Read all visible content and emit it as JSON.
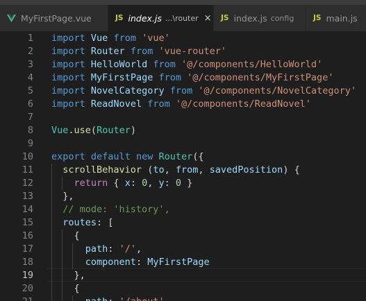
{
  "tabs": [
    {
      "filename": "MyFirstPage.vue",
      "description": "",
      "icon": "vue-icon",
      "active": false,
      "italic": false
    },
    {
      "filename": "index.js",
      "description": "...\\router",
      "icon": "js-icon",
      "active": true,
      "italic": true,
      "close": "×"
    },
    {
      "filename": "index.js",
      "description": "config",
      "icon": "js-icon",
      "active": false,
      "italic": false
    },
    {
      "filename": "main.js",
      "description": "",
      "icon": "js-icon",
      "active": false,
      "italic": false
    }
  ],
  "js_icon_label": "JS",
  "editor": {
    "current_line": 19,
    "line_numbers": [
      "1",
      "2",
      "3",
      "4",
      "5",
      "6",
      "7",
      "8",
      "9",
      "10",
      "11",
      "12",
      "13",
      "14",
      "15",
      "16",
      "17",
      "18",
      "19",
      "20",
      "21"
    ],
    "lines": [
      [
        [
          "kw",
          "import"
        ],
        [
          "pl",
          " "
        ],
        [
          "var",
          "Vue"
        ],
        [
          "pl",
          " "
        ],
        [
          "kw",
          "from"
        ],
        [
          "pl",
          " "
        ],
        [
          "str",
          "'vue'"
        ]
      ],
      [
        [
          "kw",
          "import"
        ],
        [
          "pl",
          " "
        ],
        [
          "var",
          "Router"
        ],
        [
          "pl",
          " "
        ],
        [
          "kw",
          "from"
        ],
        [
          "pl",
          " "
        ],
        [
          "str",
          "'vue-router'"
        ]
      ],
      [
        [
          "kw",
          "import"
        ],
        [
          "pl",
          " "
        ],
        [
          "var",
          "HelloWorld"
        ],
        [
          "pl",
          " "
        ],
        [
          "kw",
          "from"
        ],
        [
          "pl",
          " "
        ],
        [
          "str",
          "'@/components/HelloWorld'"
        ]
      ],
      [
        [
          "kw",
          "import"
        ],
        [
          "pl",
          " "
        ],
        [
          "var",
          "MyFirstPage"
        ],
        [
          "pl",
          " "
        ],
        [
          "kw",
          "from"
        ],
        [
          "pl",
          " "
        ],
        [
          "str",
          "'@/components/MyFirstPage'"
        ]
      ],
      [
        [
          "kw",
          "import"
        ],
        [
          "pl",
          " "
        ],
        [
          "var",
          "NovelCategory"
        ],
        [
          "pl",
          " "
        ],
        [
          "kw",
          "from"
        ],
        [
          "pl",
          " "
        ],
        [
          "str",
          "'@/components/NovelCategory'"
        ]
      ],
      [
        [
          "kw",
          "import"
        ],
        [
          "pl",
          " "
        ],
        [
          "var",
          "ReadNovel"
        ],
        [
          "pl",
          " "
        ],
        [
          "kw",
          "from"
        ],
        [
          "pl",
          " "
        ],
        [
          "str",
          "'@/components/ReadNovel'"
        ]
      ],
      [],
      [
        [
          "cls",
          "Vue"
        ],
        [
          "pl",
          "."
        ],
        [
          "fn",
          "use"
        ],
        [
          "pl",
          "("
        ],
        [
          "cls",
          "Router"
        ],
        [
          "pl",
          ")"
        ]
      ],
      [],
      [
        [
          "kw",
          "export"
        ],
        [
          "pl",
          " "
        ],
        [
          "kw",
          "default"
        ],
        [
          "pl",
          " "
        ],
        [
          "kw",
          "new"
        ],
        [
          "pl",
          " "
        ],
        [
          "cls",
          "Router"
        ],
        [
          "pl",
          "({"
        ]
      ],
      [
        [
          "pl",
          "  "
        ],
        [
          "fn",
          "scrollBehavior"
        ],
        [
          "pl",
          " ("
        ],
        [
          "var",
          "to"
        ],
        [
          "pl",
          ", "
        ],
        [
          "var",
          "from"
        ],
        [
          "pl",
          ", "
        ],
        [
          "var",
          "savedPosition"
        ],
        [
          "pl",
          ") {"
        ]
      ],
      [
        [
          "pl",
          "    "
        ],
        [
          "ctrl",
          "return"
        ],
        [
          "pl",
          " { "
        ],
        [
          "var",
          "x"
        ],
        [
          "pl",
          ": "
        ],
        [
          "num",
          "0"
        ],
        [
          "pl",
          ", "
        ],
        [
          "var",
          "y"
        ],
        [
          "pl",
          ": "
        ],
        [
          "num",
          "0"
        ],
        [
          "pl",
          " }"
        ]
      ],
      [
        [
          "pl",
          "  },"
        ]
      ],
      [
        [
          "pl",
          "  "
        ],
        [
          "cm",
          "// mode: 'history',"
        ]
      ],
      [
        [
          "pl",
          "  "
        ],
        [
          "var",
          "routes"
        ],
        [
          "pl",
          ": ["
        ]
      ],
      [
        [
          "pl",
          "    {"
        ]
      ],
      [
        [
          "pl",
          "      "
        ],
        [
          "var",
          "path"
        ],
        [
          "pl",
          ": "
        ],
        [
          "str",
          "'/'"
        ],
        [
          "pl",
          ","
        ]
      ],
      [
        [
          "pl",
          "      "
        ],
        [
          "var",
          "component"
        ],
        [
          "pl",
          ": "
        ],
        [
          "var",
          "MyFirstPage"
        ]
      ],
      [
        [
          "pl",
          "    },"
        ]
      ],
      [
        [
          "pl",
          "    {"
        ]
      ],
      [
        [
          "pl",
          "      "
        ],
        [
          "var",
          "path"
        ],
        [
          "pl",
          ": "
        ],
        [
          "str",
          "'/about'"
        ],
        [
          "pl",
          ","
        ]
      ]
    ]
  }
}
